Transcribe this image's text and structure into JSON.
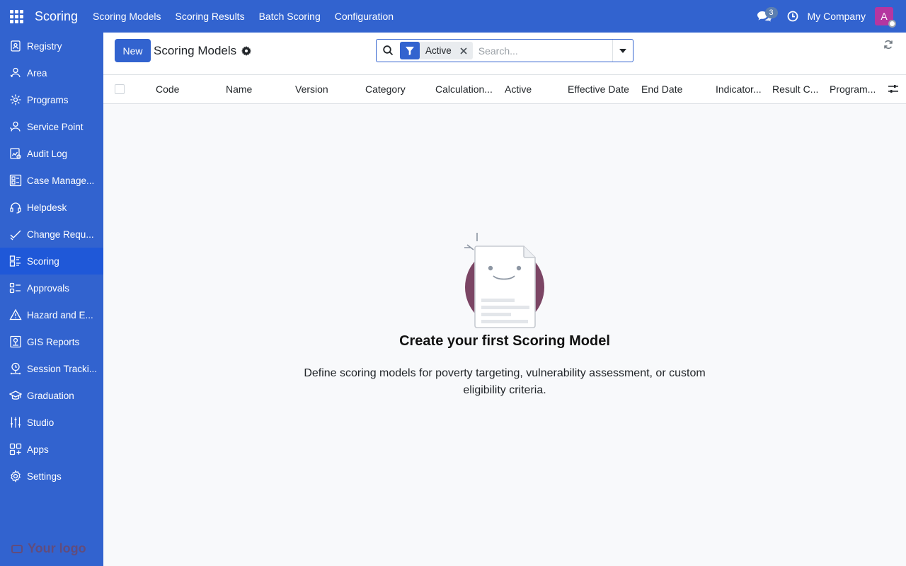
{
  "topbar": {
    "brand": "Scoring",
    "menu": [
      "Scoring Models",
      "Scoring Results",
      "Batch Scoring",
      "Configuration"
    ],
    "messages_count": "3",
    "company": "My Company",
    "avatar_initial": "A",
    "accent": "#3263cf",
    "avatar_color": "#b536a0"
  },
  "sidebar": {
    "items": [
      {
        "label": "Registry",
        "icon": "registry-icon"
      },
      {
        "label": "Area",
        "icon": "area-icon"
      },
      {
        "label": "Programs",
        "icon": "programs-icon"
      },
      {
        "label": "Service Point",
        "icon": "service-point-icon"
      },
      {
        "label": "Audit Log",
        "icon": "audit-log-icon"
      },
      {
        "label": "Case Manage...",
        "icon": "case-management-icon"
      },
      {
        "label": "Helpdesk",
        "icon": "headset-icon"
      },
      {
        "label": "Change Requ...",
        "icon": "check-icon"
      },
      {
        "label": "Scoring",
        "icon": "scoring-icon",
        "active": true
      },
      {
        "label": "Approvals",
        "icon": "approvals-icon"
      },
      {
        "label": "Hazard and E...",
        "icon": "warning-icon"
      },
      {
        "label": "GIS Reports",
        "icon": "gis-reports-icon"
      },
      {
        "label": "Session Tracki...",
        "icon": "session-tracking-icon"
      },
      {
        "label": "Graduation",
        "icon": "graduation-cap-icon"
      },
      {
        "label": "Studio",
        "icon": "studio-sliders-icon"
      },
      {
        "label": "Apps",
        "icon": "apps-icon"
      },
      {
        "label": "Settings",
        "icon": "gear-icon"
      }
    ],
    "logo_text": "Your logo"
  },
  "control_panel": {
    "new_label": "New",
    "title": "Scoring Models",
    "search": {
      "facet": "Active",
      "placeholder": "Search..."
    }
  },
  "table": {
    "columns": [
      "Code",
      "Name",
      "Version",
      "Category",
      "Calculation...",
      "Active",
      "Effective Date",
      "End Date",
      "Indicator...",
      "Result C...",
      "Program..."
    ]
  },
  "empty_state": {
    "title": "Create your first Scoring Model",
    "description": "Define scoring models for poverty targeting, vulnerability assessment, or custom eligibility criteria."
  }
}
